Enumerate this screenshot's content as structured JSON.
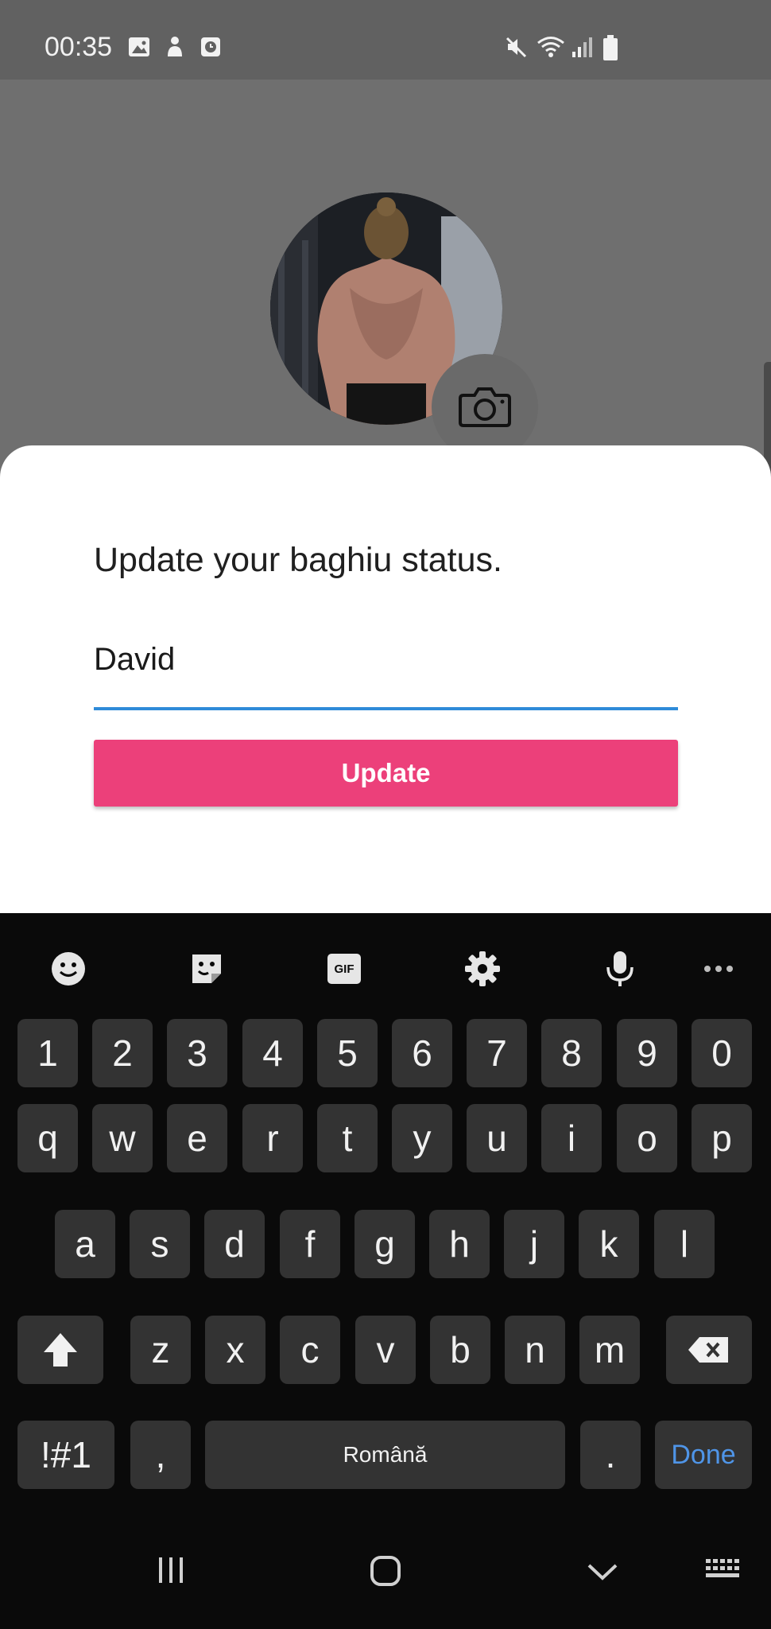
{
  "status_bar": {
    "time": "00:35",
    "left_icons": [
      "image-icon",
      "sticker-icon",
      "clock-badge-icon"
    ],
    "right_icons": [
      "mute-icon",
      "wifi-icon",
      "signal-icon",
      "battery-icon"
    ]
  },
  "dialog": {
    "title": "Update your baghiu status.",
    "input_value": "David",
    "button_label": "Update"
  },
  "colors": {
    "accent_pink": "#ec407a",
    "input_focus_blue": "#2e8bd9",
    "done_blue": "#4f95e8",
    "key_bg": "#333333"
  },
  "keyboard": {
    "toolbar": [
      "emoji-icon",
      "sticker-icon",
      "gif-icon",
      "settings-icon",
      "mic-icon",
      "more-icon"
    ],
    "gif_label": "GIF",
    "row_numbers": [
      "1",
      "2",
      "3",
      "4",
      "5",
      "6",
      "7",
      "8",
      "9",
      "0"
    ],
    "row_1": [
      "q",
      "w",
      "e",
      "r",
      "t",
      "y",
      "u",
      "i",
      "o",
      "p"
    ],
    "row_2": [
      "a",
      "s",
      "d",
      "f",
      "g",
      "h",
      "j",
      "k",
      "l"
    ],
    "row_3": [
      "z",
      "x",
      "c",
      "v",
      "b",
      "n",
      "m"
    ],
    "symbols_label": "!#1",
    "comma_label": ",",
    "space_label": "Română",
    "period_label": ".",
    "done_label": "Done"
  },
  "nav_bar": [
    "recents-icon",
    "home-icon",
    "back-icon",
    "keyboard-switch-icon"
  ]
}
